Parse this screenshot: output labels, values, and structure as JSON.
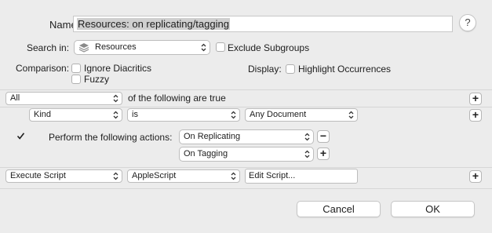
{
  "name": {
    "label": "Name:",
    "value": "Resources: on replicating/tagging"
  },
  "help": {
    "glyph": "?"
  },
  "search_in": {
    "label": "Search in:",
    "value": "Resources",
    "icon": "group-stack-icon"
  },
  "exclude_subgroups": {
    "label": "Exclude Subgroups",
    "checked": false
  },
  "comparison": {
    "label": "Comparison:",
    "ignore_diacritics": {
      "label": "Ignore Diacritics",
      "checked": false
    },
    "fuzzy": {
      "label": "Fuzzy",
      "checked": false
    }
  },
  "display": {
    "label": "Display:",
    "highlight": {
      "label": "Highlight Occurrences",
      "checked": false
    }
  },
  "match": {
    "value": "All",
    "text": "of the following are true"
  },
  "criterion": {
    "field": "Kind",
    "operator": "is",
    "value": "Any Document"
  },
  "perform": {
    "checked": true,
    "label": "Perform the following actions:",
    "actions": [
      "On Replicating",
      "On Tagging"
    ]
  },
  "script": {
    "type": "Execute Script",
    "language": "AppleScript",
    "edit_label": "Edit Script..."
  },
  "buttons": {
    "cancel": "Cancel",
    "ok": "OK",
    "plus": "+",
    "minus": "−"
  },
  "colors": {
    "background": "#ececec",
    "separator": "#d6d6d6",
    "field_selection": "#cfcfcf"
  }
}
